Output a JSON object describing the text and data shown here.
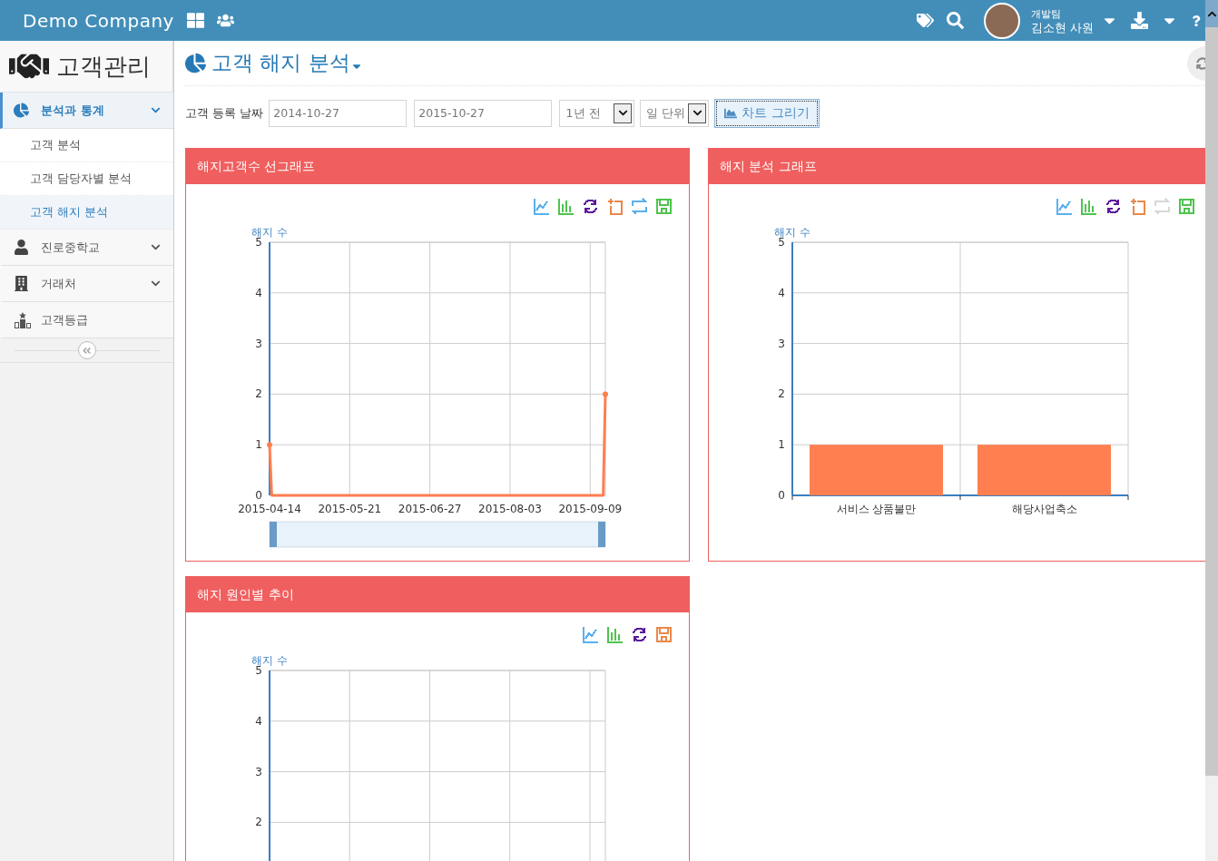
{
  "topbar": {
    "brand": "Demo Company",
    "user": {
      "team": "개발팀",
      "name": "김소현 사원"
    }
  },
  "sidebar": {
    "title": "고객관리",
    "items": [
      {
        "kind": "group",
        "label": "분석과 통계",
        "selected": true,
        "expanded": true,
        "children": [
          {
            "label": "고객 분석",
            "selected": false
          },
          {
            "label": "고객 담당자별 분석",
            "selected": false
          },
          {
            "label": "고객 해지 분석",
            "selected": true
          }
        ]
      },
      {
        "kind": "group",
        "label": "진로중학교",
        "selected": false,
        "expanded": false
      },
      {
        "kind": "group",
        "label": "거래처",
        "selected": false,
        "expanded": false
      },
      {
        "kind": "link",
        "label": "고객등급",
        "selected": false
      }
    ]
  },
  "page": {
    "title": "고객 해지 분석"
  },
  "filter": {
    "label": "고객 등록 날짜",
    "from": "2014-10-27",
    "to": "2015-10-27",
    "range": "1년 전",
    "unit": "일 단위",
    "submit": "차트 그리기"
  },
  "panels": [
    {
      "title": "해지고객수 선그래프",
      "data_zoom": true,
      "toolbox": [
        {
          "kind": "line",
          "disabled": false
        },
        {
          "kind": "bar",
          "disabled": false
        },
        {
          "kind": "refresh",
          "disabled": false
        },
        {
          "kind": "zoom",
          "disabled": false
        },
        {
          "kind": "swap",
          "disabled": false
        },
        {
          "kind": "save",
          "disabled": false
        }
      ],
      "chart_data": {
        "type": "line",
        "ylabel": "해지 수",
        "grid": true,
        "ylim": [
          0,
          5
        ],
        "yticks": [
          0,
          1,
          2,
          3,
          4,
          5
        ],
        "categories": [
          "2015-04-14",
          null,
          null,
          null,
          null,
          null,
          null,
          null,
          null,
          null,
          null,
          null,
          null,
          null,
          null,
          null,
          null,
          null,
          null,
          null,
          null,
          null,
          null,
          null,
          null,
          null,
          null,
          null,
          null,
          null,
          null,
          null,
          null,
          null,
          null,
          null,
          null,
          "2015-05-21",
          null,
          null,
          null,
          null,
          null,
          null,
          null,
          null,
          null,
          null,
          null,
          null,
          null,
          null,
          null,
          null,
          null,
          null,
          null,
          null,
          null,
          null,
          null,
          null,
          null,
          null,
          null,
          null,
          null,
          null,
          null,
          null,
          null,
          null,
          null,
          null,
          "2015-06-27",
          null,
          null,
          null,
          null,
          null,
          null,
          null,
          null,
          null,
          null,
          null,
          null,
          null,
          null,
          null,
          null,
          null,
          null,
          null,
          null,
          null,
          null,
          null,
          null,
          null,
          null,
          null,
          null,
          null,
          null,
          null,
          null,
          null,
          null,
          null,
          null,
          "2015-08-03",
          null,
          null,
          null,
          null,
          null,
          null,
          null,
          null,
          null,
          null,
          null,
          null,
          null,
          null,
          null,
          null,
          null,
          null,
          null,
          null,
          null,
          null,
          null,
          null,
          null,
          null,
          null,
          null,
          null,
          null,
          null,
          null,
          null,
          null,
          null,
          null,
          "2015-09-09",
          null,
          null,
          null,
          null,
          null,
          null,
          null
        ],
        "series": [
          {
            "color": "#ff7f50",
            "values": [
              1,
              0,
              0,
              0,
              0,
              0,
              0,
              0,
              0,
              0,
              0,
              0,
              0,
              0,
              0,
              0,
              0,
              0,
              0,
              0,
              0,
              0,
              0,
              0,
              0,
              0,
              0,
              0,
              0,
              0,
              0,
              0,
              0,
              0,
              0,
              0,
              0,
              0,
              0,
              0,
              0,
              0,
              0,
              0,
              0,
              0,
              0,
              0,
              0,
              0,
              0,
              0,
              0,
              0,
              0,
              0,
              0,
              0,
              0,
              0,
              0,
              0,
              0,
              0,
              0,
              0,
              0,
              0,
              0,
              0,
              0,
              0,
              0,
              0,
              0,
              0,
              0,
              0,
              0,
              0,
              0,
              0,
              0,
              0,
              0,
              0,
              0,
              0,
              0,
              0,
              0,
              0,
              0,
              0,
              0,
              0,
              0,
              0,
              0,
              0,
              0,
              0,
              0,
              0,
              0,
              0,
              0,
              0,
              0,
              0,
              0,
              0,
              0,
              0,
              0,
              0,
              0,
              0,
              0,
              0,
              0,
              0,
              0,
              0,
              0,
              0,
              0,
              0,
              0,
              0,
              0,
              0,
              0,
              0,
              0,
              0,
              0,
              0,
              0,
              0,
              0,
              0,
              0,
              0,
              0,
              0,
              0,
              0,
              0,
              0,
              0,
              0,
              0,
              0,
              0,
              2
            ]
          }
        ]
      }
    },
    {
      "title": "해지 분석 그래프",
      "data_zoom": false,
      "toolbox": [
        {
          "kind": "line",
          "disabled": false
        },
        {
          "kind": "bar",
          "disabled": false
        },
        {
          "kind": "refresh",
          "disabled": false
        },
        {
          "kind": "zoom",
          "disabled": false
        },
        {
          "kind": "swap",
          "disabled": true
        },
        {
          "kind": "save",
          "disabled": false
        }
      ],
      "chart_data": {
        "type": "bar",
        "ylabel": "해지 수",
        "grid": true,
        "categories": [
          "서비스 상품불만",
          "해당사업축소"
        ],
        "ylim": [
          0,
          5
        ],
        "yticks": [
          0,
          1,
          2,
          3,
          4,
          5
        ],
        "series": [
          {
            "color": "#ff7f50",
            "values": [
              1,
              1
            ]
          }
        ]
      }
    },
    {
      "title": "해지 원인별 추이",
      "data_zoom": false,
      "toolbox": [
        {
          "kind": "line",
          "disabled": false
        },
        {
          "kind": "bar",
          "disabled": false
        },
        {
          "kind": "refresh",
          "disabled": false
        },
        {
          "kind": "save",
          "disabled": false
        }
      ],
      "chart_data": {
        "type": "line",
        "ylabel": "해지 수",
        "grid": true,
        "categories": [
          null,
          null,
          null,
          null,
          null
        ],
        "ylim": [
          0,
          5
        ],
        "yticks": [
          2,
          3,
          4,
          5
        ]
      }
    }
  ]
}
